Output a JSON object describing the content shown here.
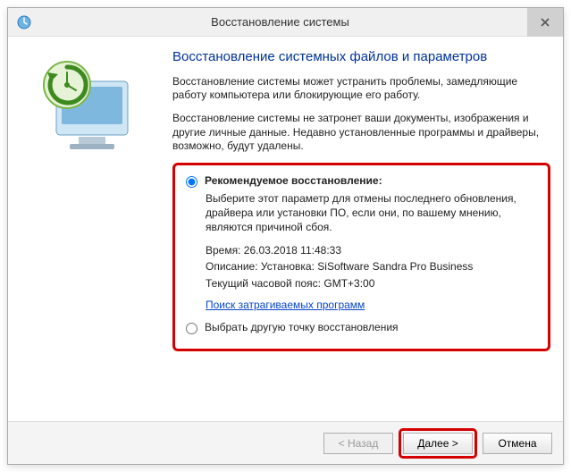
{
  "window": {
    "title": "Восстановление системы"
  },
  "heading": "Восстановление системных файлов и параметров",
  "para1": "Восстановление системы может устранить проблемы, замедляющие работу компьютера или блокирующие его работу.",
  "para2": "Восстановление системы не затронет ваши документы, изображения и другие личные данные. Недавно установленные программы и драйверы, возможно, будут удалены.",
  "option1": {
    "label": "Рекомендуемое восстановление:",
    "desc": "Выберите этот параметр для отмены последнего обновления, драйвера или установки ПО, если они, по вашему мнению, являются причиной сбоя.",
    "time_label": "Время:",
    "time_value": "26.03.2018 11:48:33",
    "desc_label": "Описание:",
    "desc_value": "Установка: SiSoftware Sandra Pro Business",
    "tz_label": "Текущий часовой пояс:",
    "tz_value": "GMT+3:00",
    "link": "Поиск затрагиваемых программ"
  },
  "option2": {
    "label": "Выбрать другую точку восстановления"
  },
  "buttons": {
    "back": "< Назад",
    "next": "Далее >",
    "cancel": "Отмена"
  }
}
